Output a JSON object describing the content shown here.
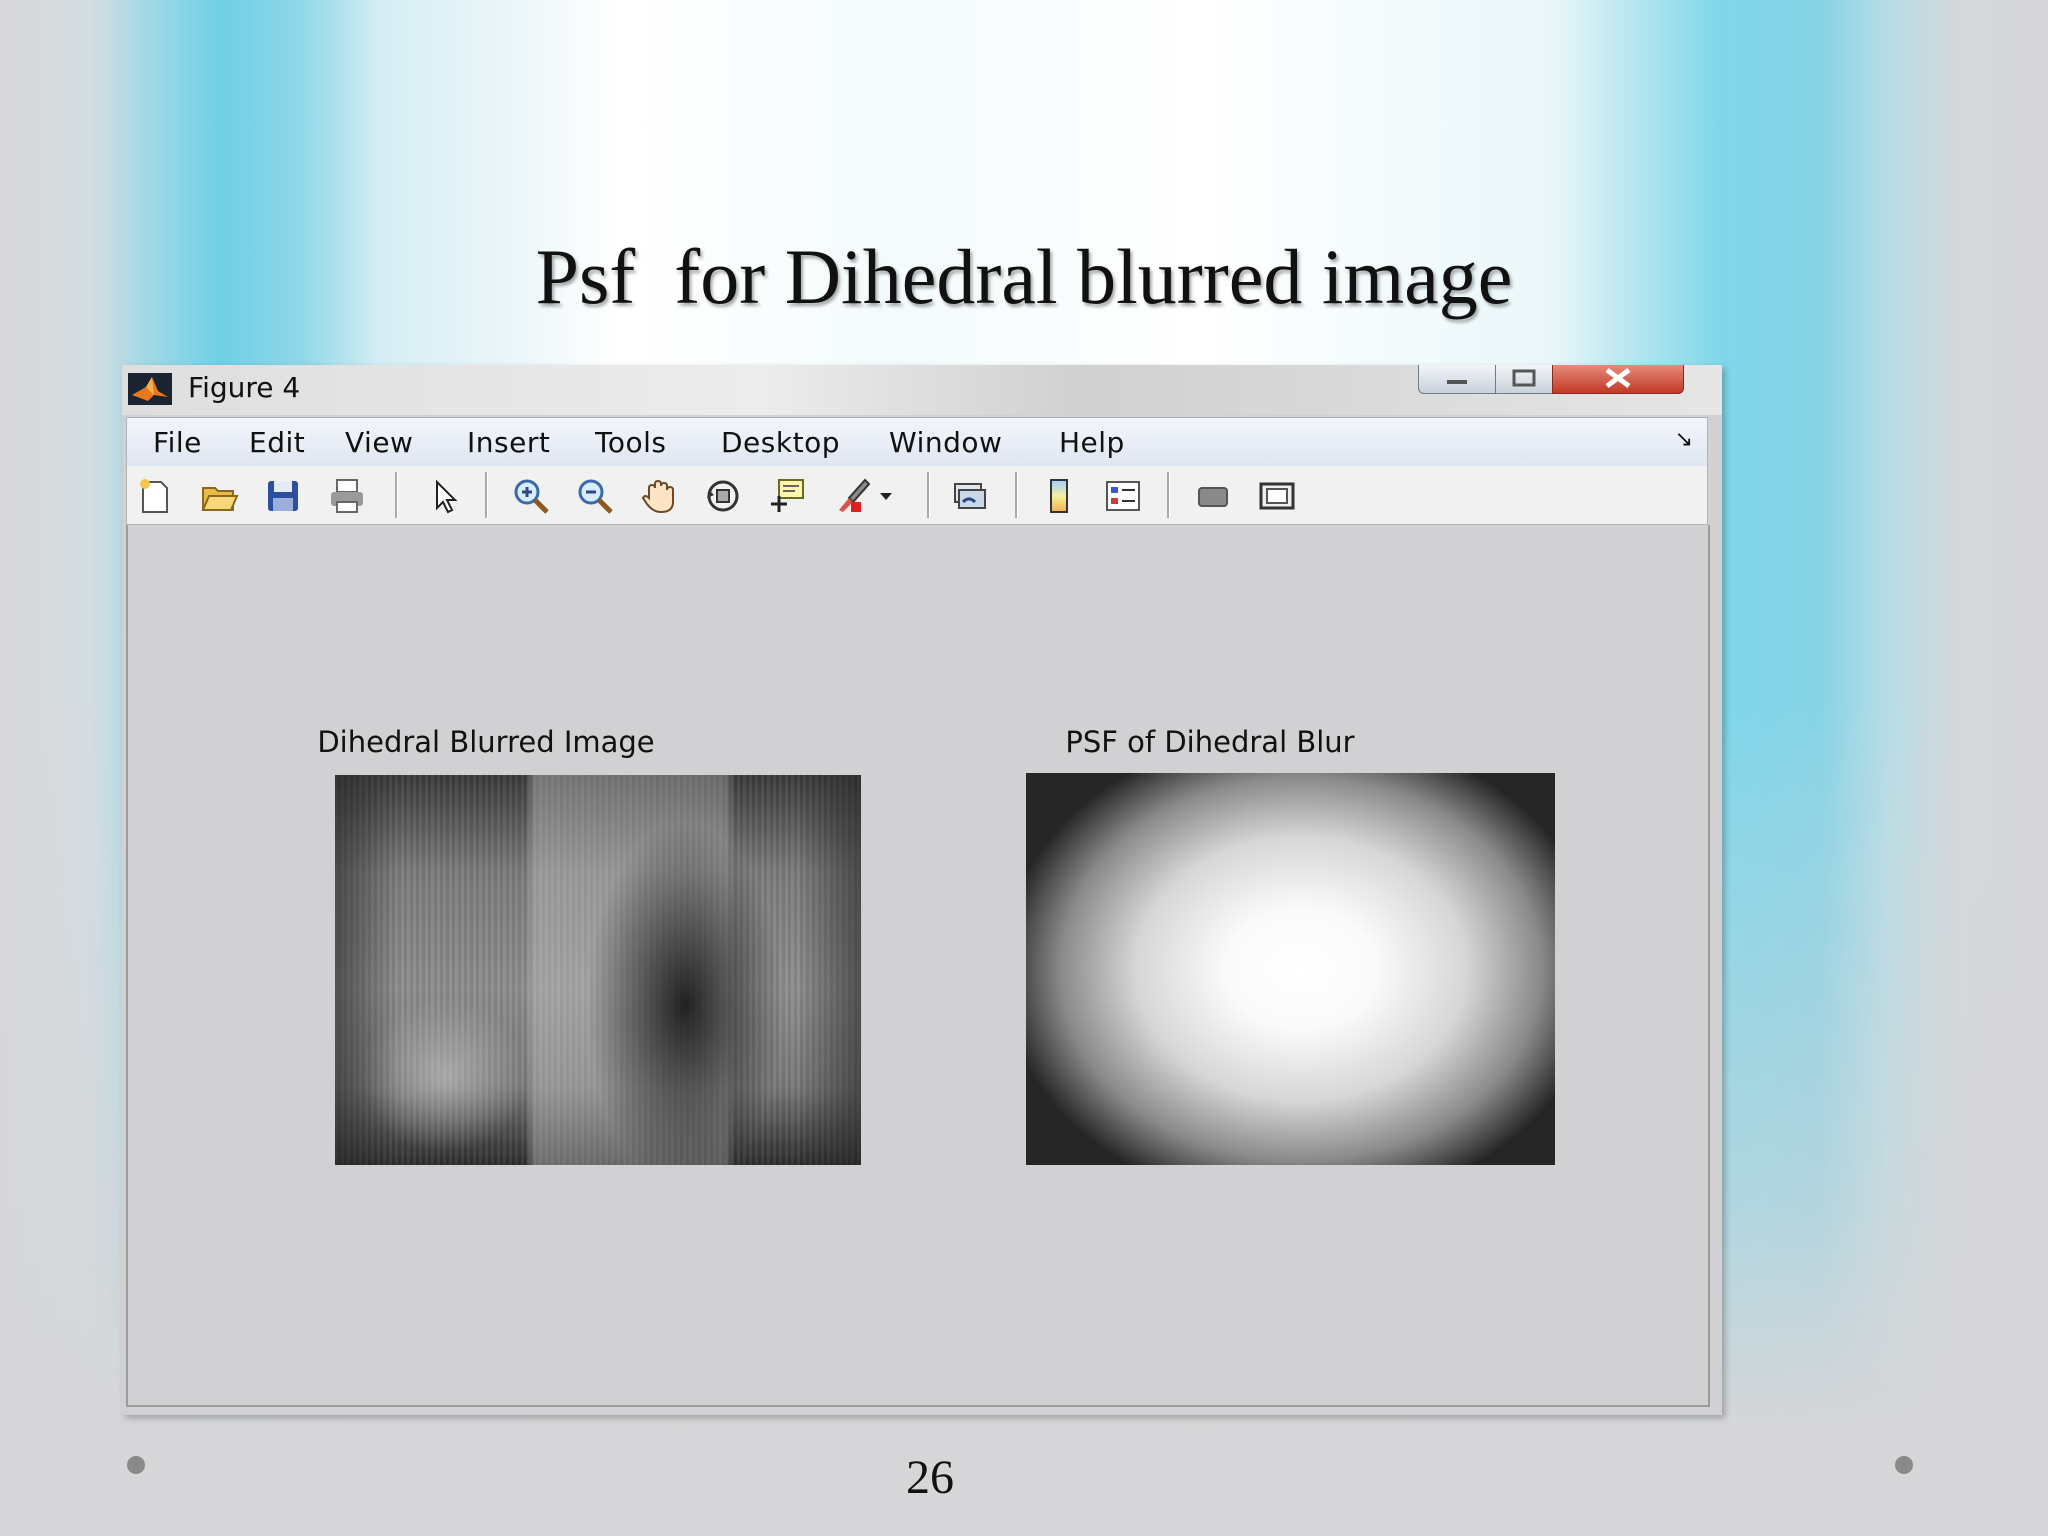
{
  "slide": {
    "title": "Psf  for Dihedral blurred image",
    "page_number": "26"
  },
  "window": {
    "title": "Figure 4",
    "app_icon": "matlab-logo-icon",
    "controls": [
      "minimize-icon",
      "maximize-icon",
      "close-icon"
    ]
  },
  "menu": {
    "items": [
      "File",
      "Edit",
      "View",
      "Insert",
      "Tools",
      "Desktop",
      "Window",
      "Help"
    ],
    "dock_arrow": "↘"
  },
  "toolbar": {
    "icons": [
      "new-figure-icon",
      "open-file-icon",
      "save-icon",
      "print-icon",
      "edit-plot-arrow-icon",
      "zoom-in-icon",
      "zoom-out-icon",
      "pan-hand-icon",
      "rotate-3d-icon",
      "data-cursor-icon",
      "brush-icon",
      "dropdown-arrow-icon",
      "link-plot-icon",
      "colorbar-icon",
      "legend-icon",
      "hide-plot-tools-icon",
      "show-plot-tools-icon"
    ]
  },
  "figure": {
    "left_title": "Dihedral Blurred Image",
    "right_title": "PSF of Dihedral Blur"
  }
}
